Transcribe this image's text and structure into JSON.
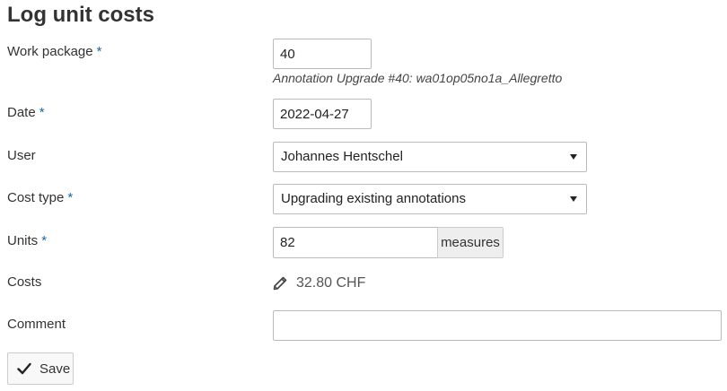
{
  "page": {
    "title": "Log unit costs"
  },
  "form": {
    "required_marker": "*",
    "work_package": {
      "label": "Work package",
      "value": "40",
      "annotation": "Annotation Upgrade #40: wa01op05no1a_Allegretto"
    },
    "date": {
      "label": "Date",
      "value": "2022-04-27"
    },
    "user": {
      "label": "User",
      "selected": "Johannes Hentschel"
    },
    "cost_type": {
      "label": "Cost type",
      "selected": "Upgrading existing annotations"
    },
    "units": {
      "label": "Units",
      "value": "82",
      "unit_name": "measures"
    },
    "costs": {
      "label": "Costs",
      "value": "32.80 CHF",
      "icon": "pencil-icon"
    },
    "comment": {
      "label": "Comment",
      "value": ""
    },
    "save_label": "Save",
    "save_icon": "check-icon"
  }
}
